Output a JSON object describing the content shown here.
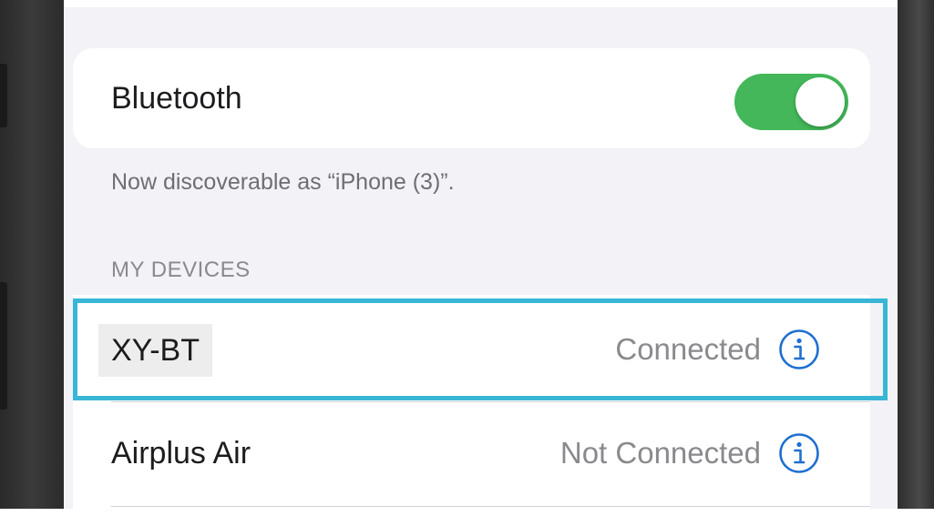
{
  "bluetooth": {
    "label": "Bluetooth",
    "enabled": true,
    "toggle_color": "#43b759"
  },
  "discoverable_text": "Now discoverable as “iPhone (3)”.",
  "my_devices": {
    "header": "MY DEVICES",
    "items": [
      {
        "name": "XY-BT",
        "status": "Connected",
        "info_icon": "info-icon"
      },
      {
        "name": "Airplus Air",
        "status": "Not Connected",
        "info_icon": "info-icon"
      }
    ]
  },
  "highlight_color": "#39b6d6",
  "info_icon_color": "#1f6fd1"
}
